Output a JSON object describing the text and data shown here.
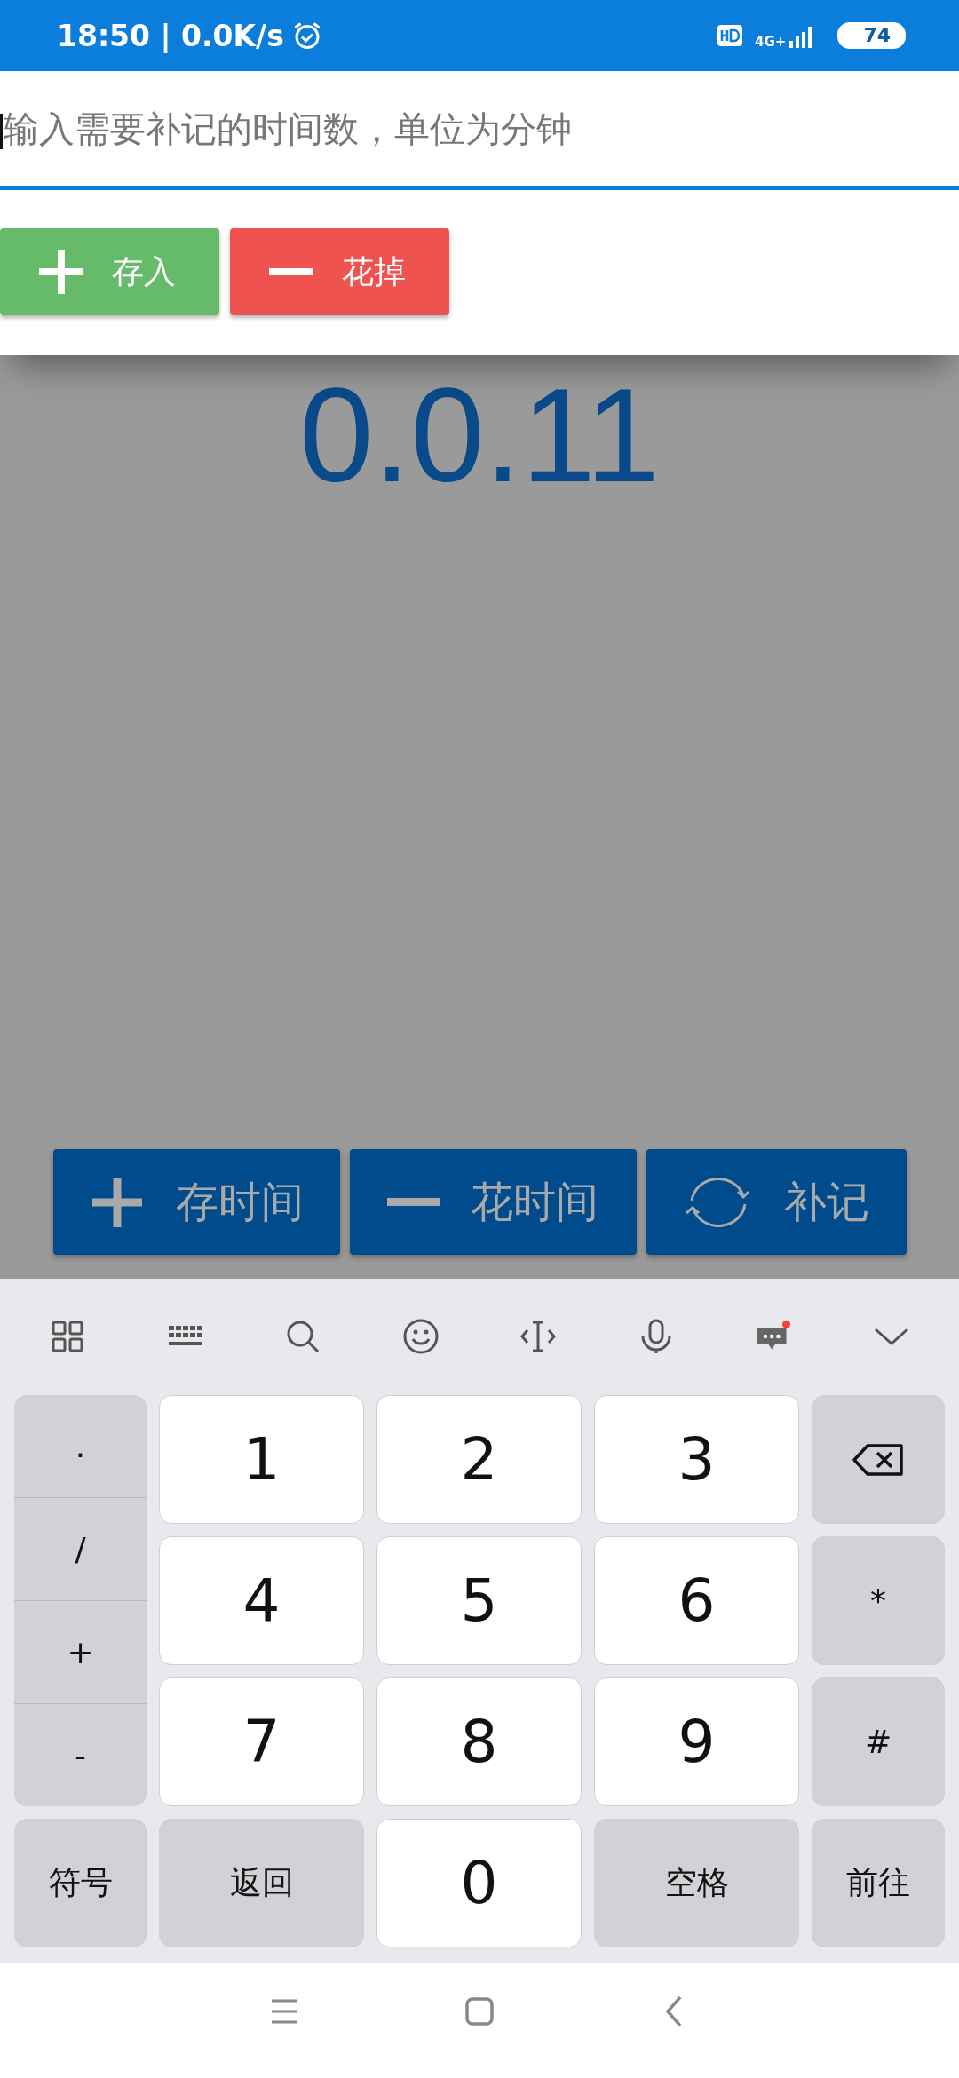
{
  "status_bar": {
    "time": "18:50 | 0.0K/s",
    "network": "4G+",
    "battery": "74"
  },
  "input": {
    "placeholder": "输入需要补记的时间数，单位为分钟"
  },
  "top_buttons": [
    {
      "kind": "add",
      "label": "存入"
    },
    {
      "kind": "subtract",
      "label": "花掉"
    }
  ],
  "counter": "0.0.11",
  "action_buttons": [
    {
      "kind": "add",
      "label": "存时间"
    },
    {
      "kind": "subtract",
      "label": "花时间"
    },
    {
      "kind": "sync",
      "label": "补记"
    }
  ],
  "keyboard": {
    "symbol_column": [
      ".",
      "/",
      "+",
      "-"
    ],
    "keys": [
      {
        "kind": "digit",
        "label": "1"
      },
      {
        "kind": "digit",
        "label": "2"
      },
      {
        "kind": "digit",
        "label": "3"
      },
      {
        "kind": "backspace"
      },
      {
        "kind": "digit",
        "label": "4"
      },
      {
        "kind": "digit",
        "label": "5"
      },
      {
        "kind": "digit",
        "label": "6"
      },
      {
        "kind": "function",
        "label": "*"
      },
      {
        "kind": "digit",
        "label": "7"
      },
      {
        "kind": "digit",
        "label": "8"
      },
      {
        "kind": "digit",
        "label": "9"
      },
      {
        "kind": "function",
        "label": "#"
      },
      {
        "kind": "function",
        "label": "符号"
      },
      {
        "kind": "function",
        "label": "返回"
      },
      {
        "kind": "digit",
        "label": "0"
      },
      {
        "kind": "function",
        "label": "空格"
      },
      {
        "kind": "function",
        "label": "前往"
      }
    ]
  }
}
